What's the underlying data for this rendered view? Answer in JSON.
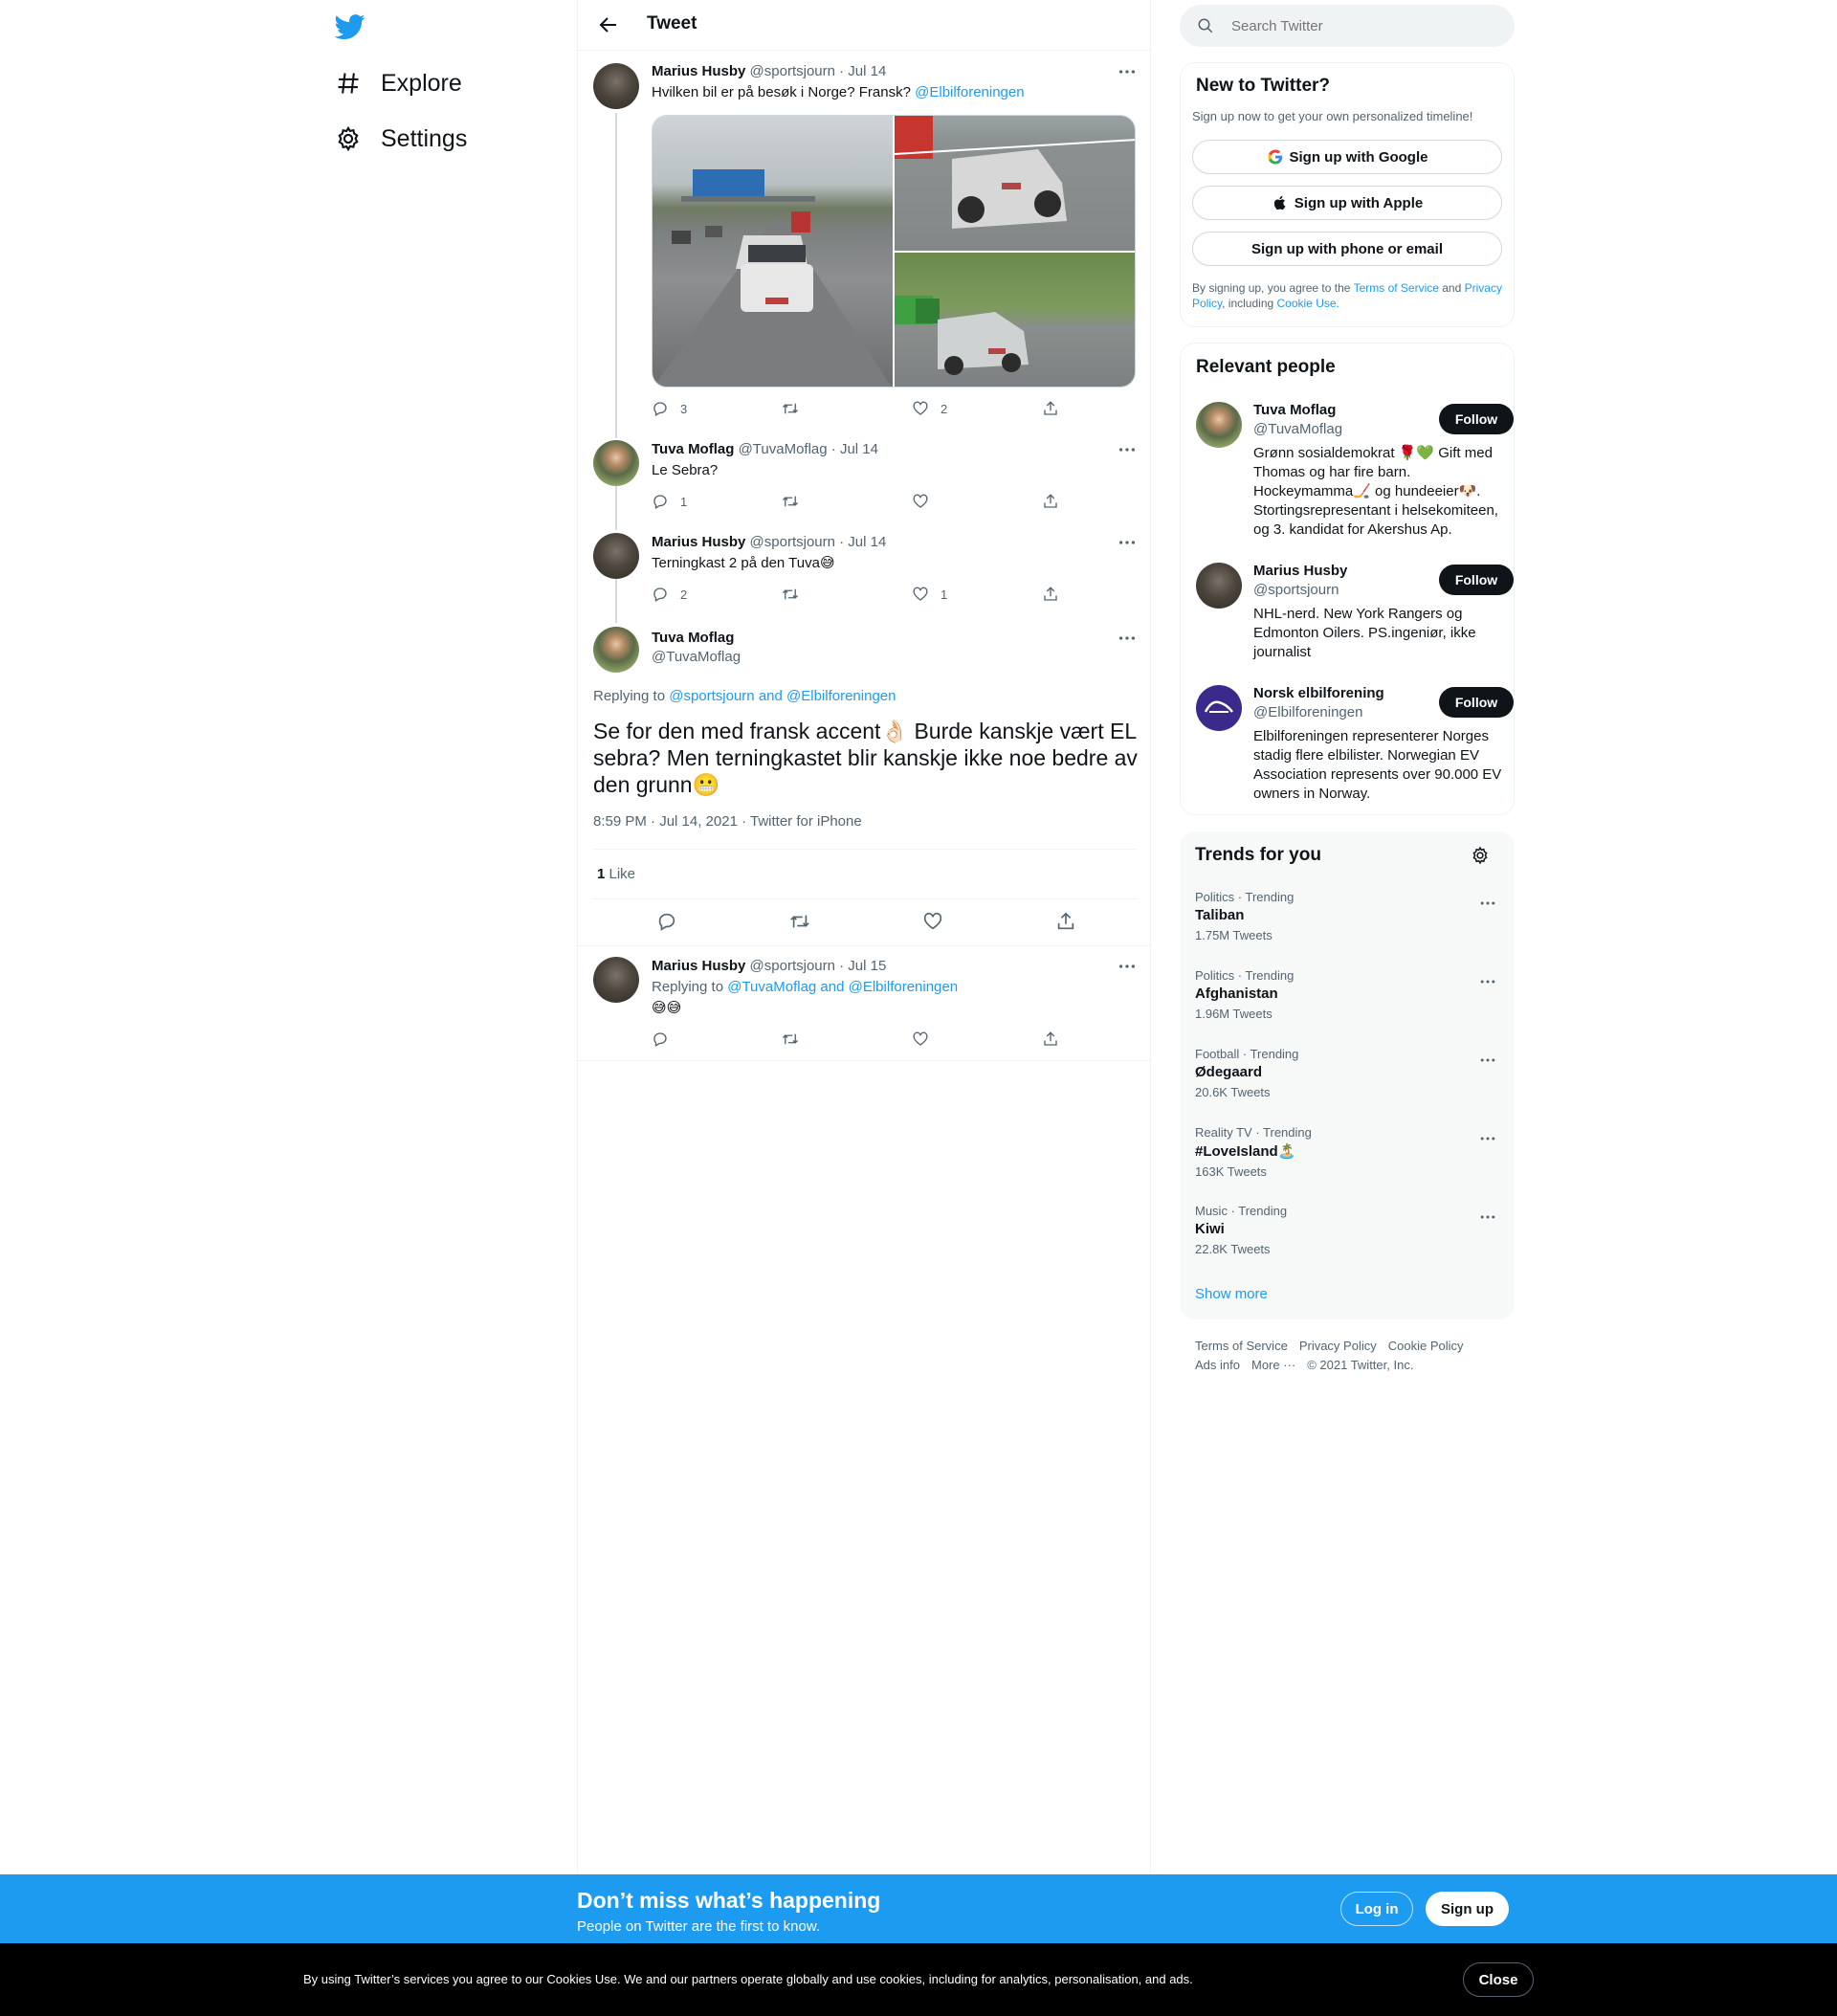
{
  "nav": {
    "items": [
      {
        "label": "Explore",
        "icon": "hashtag-icon"
      },
      {
        "label": "Settings",
        "icon": "gear-icon"
      }
    ]
  },
  "header": {
    "title": "Tweet"
  },
  "thread": [
    {
      "name": "Marius Husby",
      "handle": "@sportsjourn",
      "date": "· Jul 14",
      "text": "Hvilken bil er på besøk i Norge? Fransk? ",
      "mention": "@Elbilforeningen",
      "replies": "3",
      "retweets": "",
      "likes": "2"
    },
    {
      "name": "Tuva Moflag",
      "handle": "@TuvaMoflag",
      "date": "· Jul 14",
      "text": "Le Sebra?",
      "replies": "1",
      "retweets": "",
      "likes": ""
    },
    {
      "name": "Marius Husby",
      "handle": "@sportsjourn",
      "date": "· Jul 14",
      "text": "Terningkast 2 på den Tuva😅",
      "replies": "2",
      "retweets": "",
      "likes": "1"
    }
  ],
  "main_tweet": {
    "name": "Tuva Moflag",
    "handle": "@TuvaMoflag",
    "replying_prefix": "Replying to ",
    "replying_to": "@sportsjourn and @Elbilforeningen",
    "text": "Se for den med fransk accent👌🏻 Burde kanskje vært EL sebra? Men terningkastet blir kanskje ikke noe bedre av den grunn😬",
    "meta": "8:59 PM · Jul 14, 2021 · Twitter for iPhone",
    "like_count": "1",
    "like_label": " Like"
  },
  "reply": {
    "name": "Marius Husby",
    "handle": "@sportsjourn",
    "date": "· Jul 15",
    "replying_prefix": "Replying to ",
    "replying_to": "@TuvaMoflag and @Elbilforeningen",
    "text": "😅😅"
  },
  "search": {
    "placeholder": "Search Twitter"
  },
  "new_to_twitter": {
    "title": "New to Twitter?",
    "subtitle": "Sign up now to get your own personalized timeline!",
    "google": "Sign up with Google",
    "apple": "Sign up with Apple",
    "phone": "Sign up with phone or email",
    "legal_1": "By signing up, you agree to the ",
    "terms": "Terms of Service",
    "legal_2": " and ",
    "privacy": "Privacy Policy",
    "legal_3": ", including ",
    "cookie": "Cookie Use."
  },
  "relevant_people": {
    "title": "Relevant people",
    "follow_label": "Follow",
    "people": [
      {
        "name": "Tuva Moflag",
        "handle": "@TuvaMoflag",
        "bio": "Grønn sosialdemokrat 🌹💚 Gift med Thomas og har fire barn. Hockeymamma🏒 og hundeeier🐶. Stortingsrepresentant i helsekomiteen, og 3. kandidat for Akershus Ap."
      },
      {
        "name": "Marius Husby",
        "handle": "@sportsjourn",
        "bio": "NHL-nerd. New York Rangers og Edmonton Oilers. PS.ingeniør, ikke journalist"
      },
      {
        "name": "Norsk elbilforening",
        "handle": "@Elbilforeningen",
        "bio": "Elbilforeningen representerer Norges stadig flere elbilister. Norwegian EV Association represents over 90.000 EV owners in Norway."
      }
    ]
  },
  "trends": {
    "title": "Trends for you",
    "items": [
      {
        "category": "Politics · Trending",
        "name": "Taliban",
        "count": "1.75M Tweets"
      },
      {
        "category": "Politics · Trending",
        "name": "Afghanistan",
        "count": "1.96M Tweets"
      },
      {
        "category": "Football · Trending",
        "name": "Ødegaard",
        "count": "20.6K Tweets"
      },
      {
        "category": "Reality TV · Trending",
        "name": "#LoveIsland🏝️",
        "count": "163K Tweets"
      },
      {
        "category": "Music · Trending",
        "name": "Kiwi",
        "count": "22.8K Tweets"
      }
    ],
    "show_more": "Show more"
  },
  "footer": {
    "terms": "Terms of Service",
    "privacy": "Privacy Policy",
    "cookie": "Cookie Policy",
    "ads": "Ads info",
    "more": "More ···",
    "copyright": "© 2021 Twitter, Inc."
  },
  "banner": {
    "headline": "Don’t miss what’s happening",
    "sub": "People on Twitter are the first to know.",
    "login": "Log in",
    "signup": "Sign up"
  },
  "cookie_bar": {
    "text": "By using Twitter’s services you agree to our Cookies Use. We and our partners operate globally and use cookies, including for analytics, personalisation, and ads.",
    "close": "Close"
  },
  "colors": {
    "accent": "#1d9bf0",
    "text": "#0f1419",
    "secondary": "#536471"
  }
}
